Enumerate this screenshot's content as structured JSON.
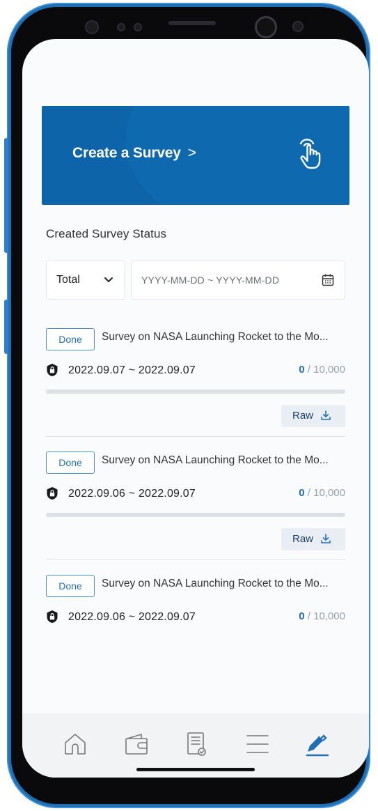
{
  "banner": {
    "title": "Create a Survey",
    "chevron": ">",
    "icon": "tap-hand-icon"
  },
  "section_title": "Created Survey Status",
  "filter": {
    "selected": "Total",
    "date_placeholder": "YYYY-MM-DD ~ YYYY-MM-DD"
  },
  "surveys": [
    {
      "status": "Done",
      "title": "Survey on NASA Launching Rocket to the Mo...",
      "dates": "2022.09.07 ~ 2022.09.07",
      "responses": "0",
      "target": " / 10,000",
      "progress": 0,
      "raw_label": "Raw"
    },
    {
      "status": "Done",
      "title": "Survey on NASA Launching Rocket to the Mo...",
      "dates": "2022.09.06 ~ 2022.09.07",
      "responses": "0",
      "target": " / 10,000",
      "progress": 0,
      "raw_label": "Raw"
    },
    {
      "status": "Done",
      "title": "Survey on NASA Launching Rocket to the Mo...",
      "dates": "2022.09.06 ~ 2022.09.07",
      "responses": "0",
      "target": " / 10,000",
      "progress": 0
    }
  ],
  "bottom_nav": {
    "items": [
      "home-icon",
      "wallet-icon",
      "survey-list-icon",
      "menu-icon",
      "pencil-icon"
    ],
    "active": "pencil-icon"
  },
  "colors": {
    "brand": "#0d64a8",
    "accent": "#1f6fb5",
    "phone_frame": "#1f6fb5"
  }
}
